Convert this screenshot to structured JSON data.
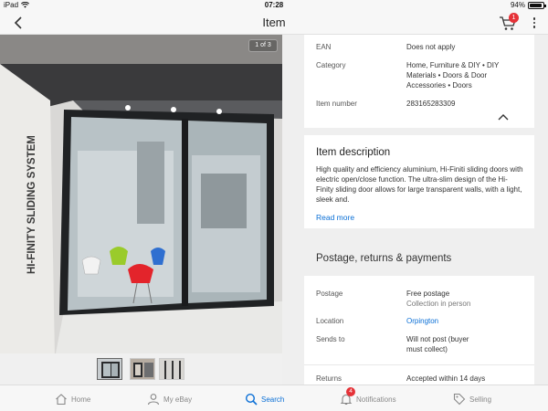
{
  "status_bar": {
    "device": "iPad",
    "time": "07:28",
    "battery": "94%",
    "battery_level": 0.94
  },
  "nav": {
    "title": "Item",
    "cart_count": "1"
  },
  "gallery": {
    "counter": "1 of 3",
    "sign_text": "HI-FINITY SLIDING SYSTEM",
    "thumbnail_count": 3,
    "selected_thumbnail": 1
  },
  "specifics": [
    {
      "key": "EAN",
      "value": "Does not apply"
    },
    {
      "key": "Category",
      "value": "Home, Furniture & DIY • DIY Materials • Doors & Door Accessories • Doors"
    },
    {
      "key": "Item number",
      "value": "283165283309"
    }
  ],
  "description": {
    "title": "Item description",
    "body": "High quality and efficiency aluminium, Hi-Finiti sliding doors with electric open/close function. The ultra-slim design of the Hi-Finity sliding door allows for large transparent walls, with a light, sleek and.",
    "read_more": "Read more"
  },
  "postage": {
    "heading": "Postage, returns & payments",
    "postage_label": "Postage",
    "postage_value": "Free postage",
    "postage_sub": "Collection in person",
    "location_label": "Location",
    "location_value": "Orpington",
    "sends_to_label": "Sends to",
    "sends_to_value": "Will not post (buyer must collect)",
    "returns_label": "Returns",
    "returns_value": "Accepted within 14 days"
  },
  "tabs": [
    {
      "label": "Home",
      "icon": "home-icon"
    },
    {
      "label": "My eBay",
      "icon": "person-icon"
    },
    {
      "label": "Search",
      "icon": "search-icon"
    },
    {
      "label": "Notifications",
      "icon": "bell-icon"
    },
    {
      "label": "Selling",
      "icon": "tag-icon"
    }
  ],
  "notifications_count": "4",
  "colors": {
    "accent": "#0a6fd6",
    "badge": "#e53238"
  }
}
